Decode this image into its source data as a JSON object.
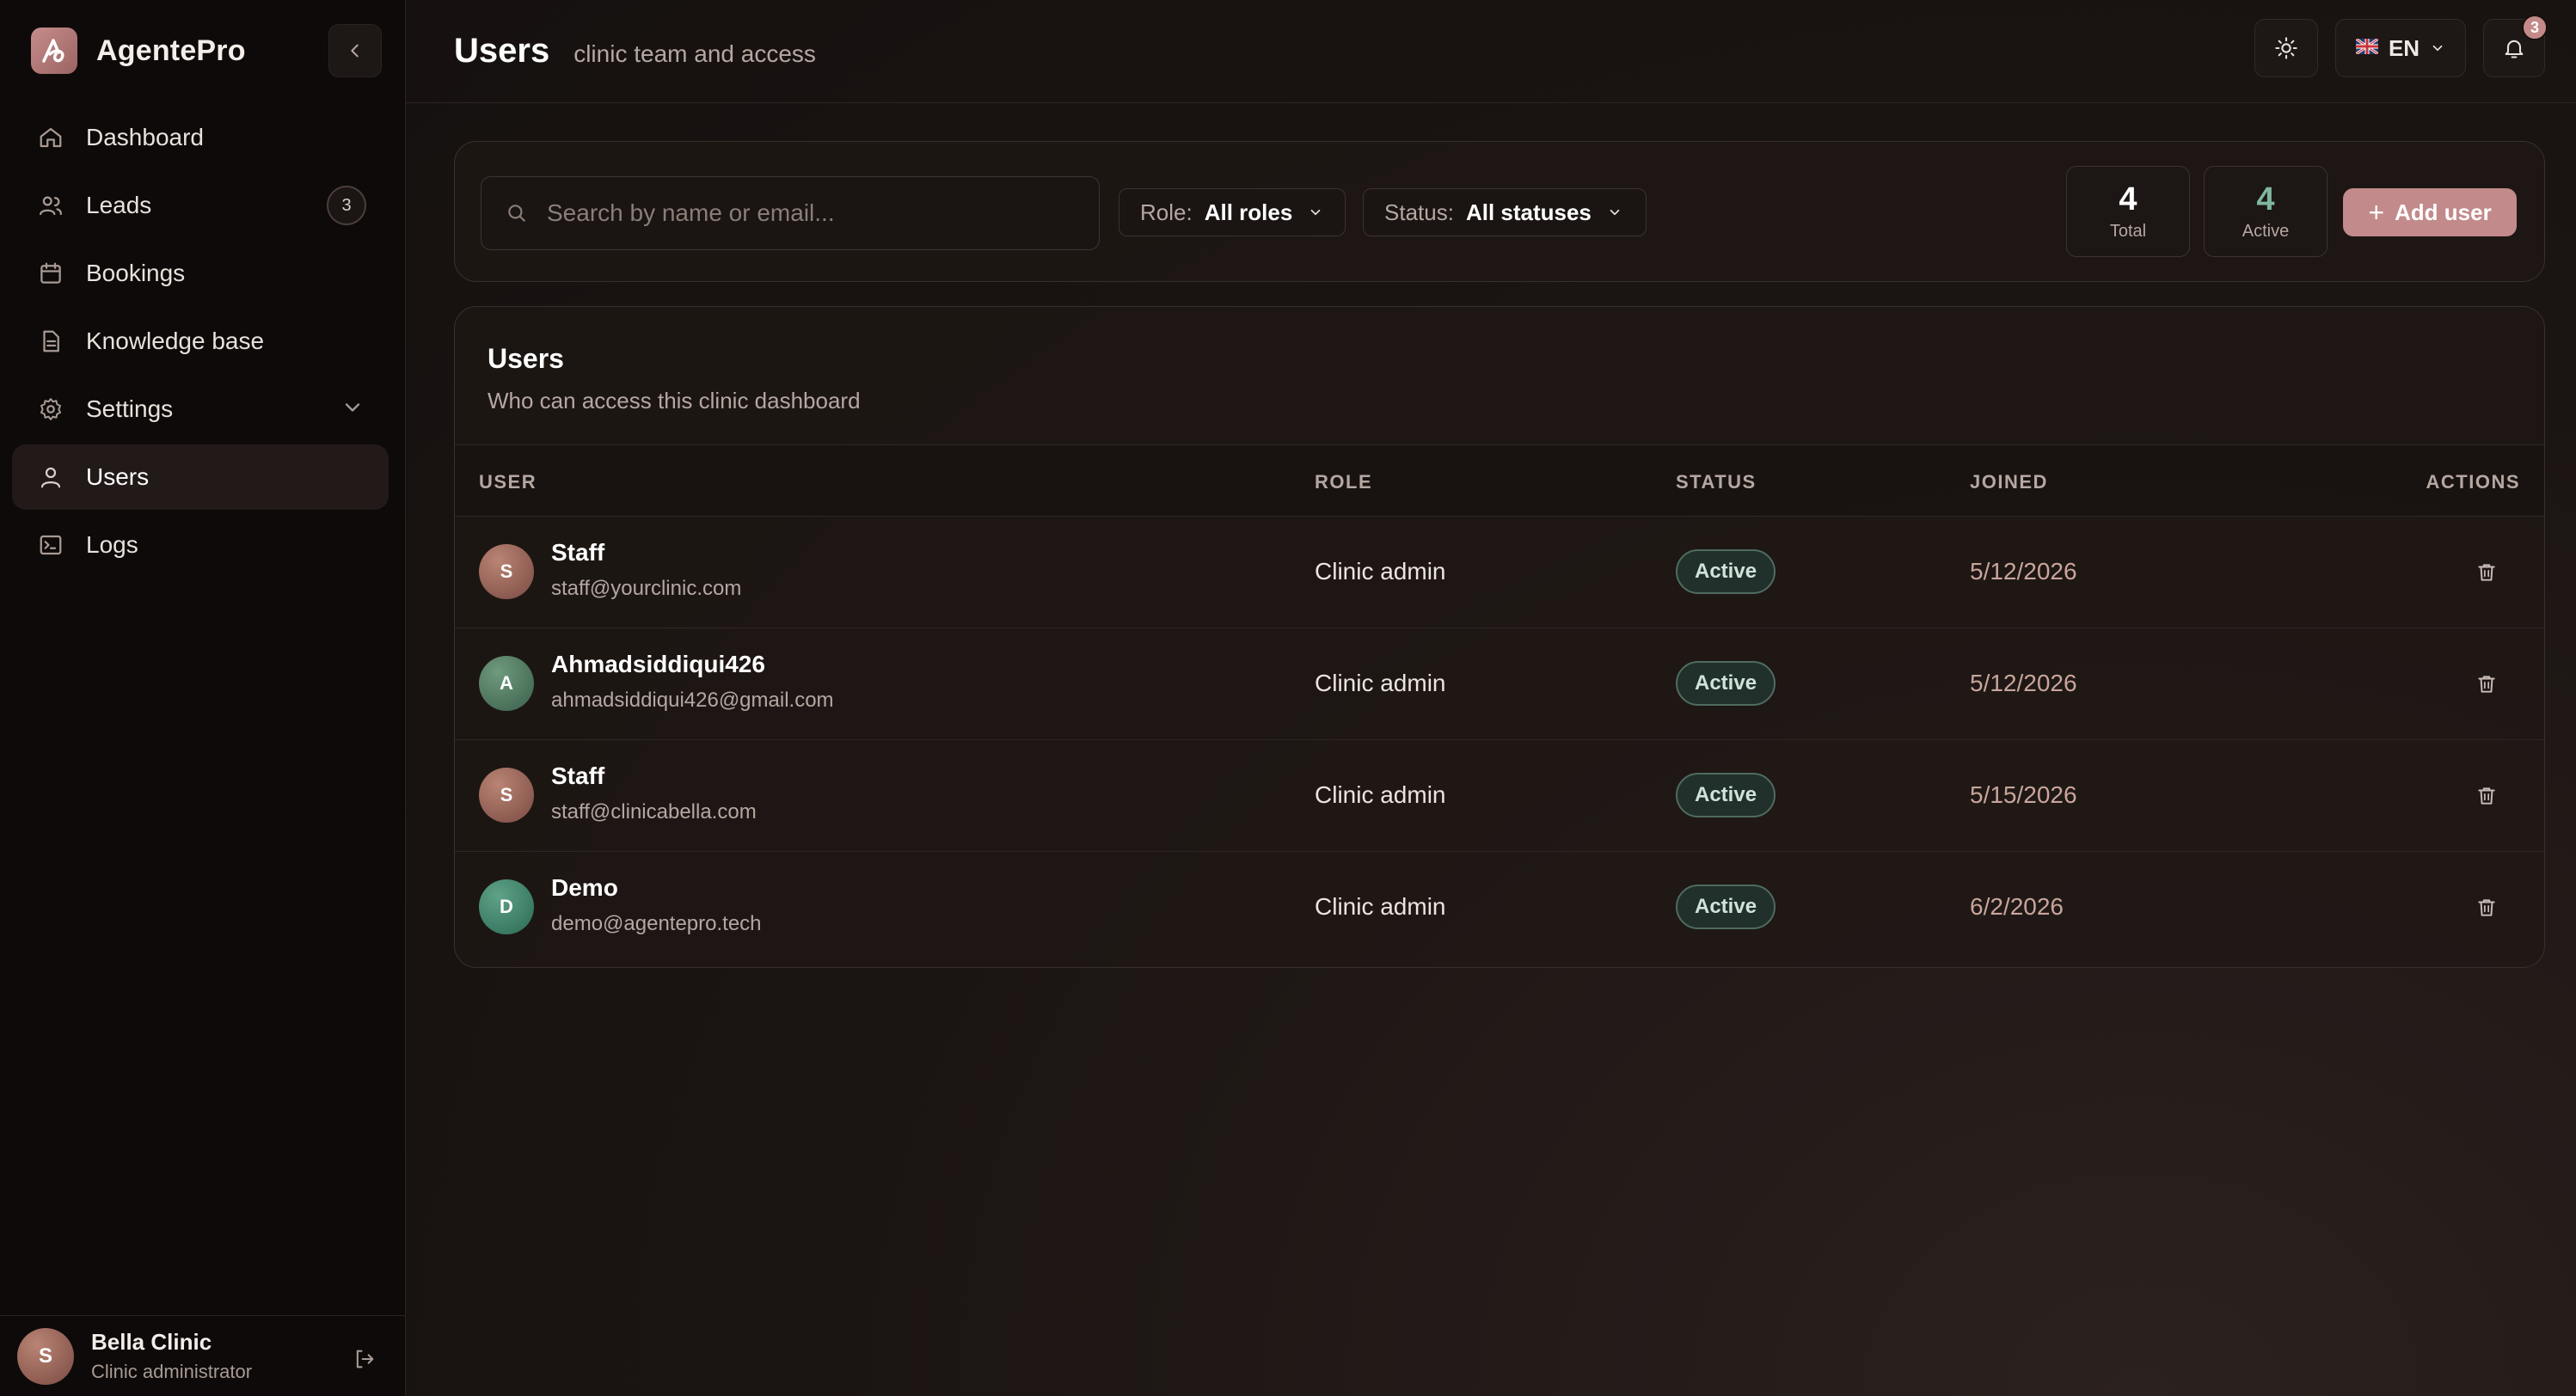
{
  "brand": {
    "name": "AgentePro"
  },
  "sidebar": {
    "items": [
      {
        "label": "Dashboard",
        "icon": "home-icon"
      },
      {
        "label": "Leads",
        "icon": "users-icon",
        "badge": "3"
      },
      {
        "label": "Bookings",
        "icon": "calendar-icon"
      },
      {
        "label": "Knowledge base",
        "icon": "document-icon"
      },
      {
        "label": "Settings",
        "icon": "gear-icon"
      },
      {
        "label": "Users",
        "icon": "user-icon",
        "active": true
      },
      {
        "label": "Logs",
        "icon": "terminal-icon"
      }
    ],
    "user": {
      "initial": "S",
      "name": "Bella Clinic",
      "role": "Clinic administrator"
    }
  },
  "header": {
    "title": "Users",
    "subtitle": "clinic team and access",
    "language": "EN",
    "notification_count": "3"
  },
  "toolbar": {
    "search_placeholder": "Search by name or email...",
    "role_filter": {
      "label": "Role:",
      "value": "All roles"
    },
    "status_filter": {
      "label": "Status:",
      "value": "All statuses"
    },
    "stats": {
      "total": {
        "value": "4",
        "label": "Total"
      },
      "active": {
        "value": "4",
        "label": "Active"
      }
    },
    "add_user_label": "Add user"
  },
  "users_card": {
    "title": "Users",
    "subtitle": "Who can access this clinic dashboard",
    "columns": {
      "user": "USER",
      "role": "ROLE",
      "status": "STATUS",
      "joined": "JOINED",
      "actions": "ACTIONS"
    },
    "rows": [
      {
        "initial": "S",
        "name": "Staff",
        "email": "staff@yourclinic.com",
        "role": "Clinic admin",
        "status": "Active",
        "joined": "5/12/2026"
      },
      {
        "initial": "A",
        "name": "Ahmadsiddiqui426",
        "email": "ahmadsiddiqui426@gmail.com",
        "role": "Clinic admin",
        "status": "Active",
        "joined": "5/12/2026"
      },
      {
        "initial": "S",
        "name": "Staff",
        "email": "staff@clinicabella.com",
        "role": "Clinic admin",
        "status": "Active",
        "joined": "5/15/2026"
      },
      {
        "initial": "D",
        "name": "Demo",
        "email": "demo@agentepro.tech",
        "role": "Clinic admin",
        "status": "Active",
        "joined": "6/2/2026"
      }
    ]
  },
  "colors": {
    "accent": "#c28a8a",
    "active_status": "#7fb6a0",
    "background": "#17110f"
  }
}
